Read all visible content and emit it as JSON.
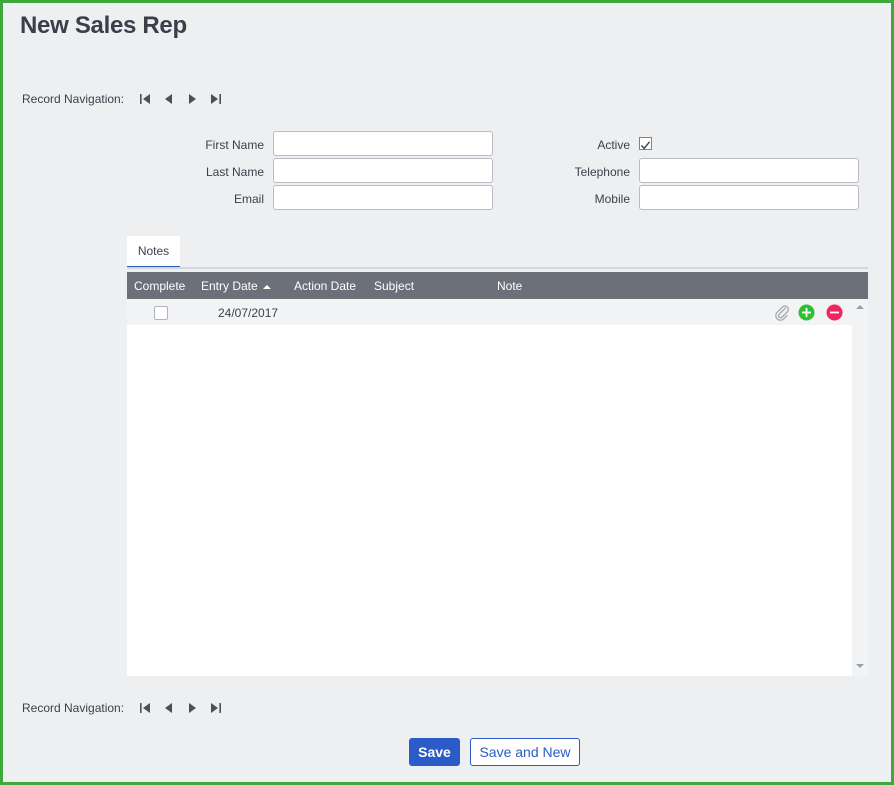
{
  "page": {
    "title": "New Sales Rep"
  },
  "record_navigation": {
    "label": "Record Navigation:",
    "buttons": [
      "first-record-icon",
      "previous-record-icon",
      "next-record-icon",
      "last-record-icon"
    ]
  },
  "form": {
    "first_name": {
      "label": "First Name",
      "value": ""
    },
    "last_name": {
      "label": "Last Name",
      "value": ""
    },
    "email": {
      "label": "Email",
      "value": ""
    },
    "active": {
      "label": "Active",
      "checked": true
    },
    "telephone": {
      "label": "Telephone",
      "value": ""
    },
    "mobile": {
      "label": "Mobile",
      "value": ""
    }
  },
  "tabs": [
    {
      "label": "Notes",
      "selected": true
    }
  ],
  "notes_grid": {
    "columns": [
      "Complete",
      "Entry Date",
      "Action Date",
      "Subject",
      "Note"
    ],
    "sort_column": "Entry Date",
    "sort_direction": "ascending",
    "rows": [
      {
        "complete": false,
        "entry_date": "24/07/2017",
        "action_date": "",
        "subject": "",
        "note": ""
      }
    ],
    "row_icons": [
      "paperclip-icon",
      "add-row-icon",
      "remove-row-icon"
    ]
  },
  "actions": {
    "save": "Save",
    "save_and_new": "Save and New"
  },
  "colors": {
    "frame_border": "#3ea83e",
    "background": "#eeeff1",
    "grid_header": "#6b7079",
    "accent": "#2a5bc6",
    "add_icon": "#2fbf2f",
    "remove_icon": "#f0245e"
  }
}
